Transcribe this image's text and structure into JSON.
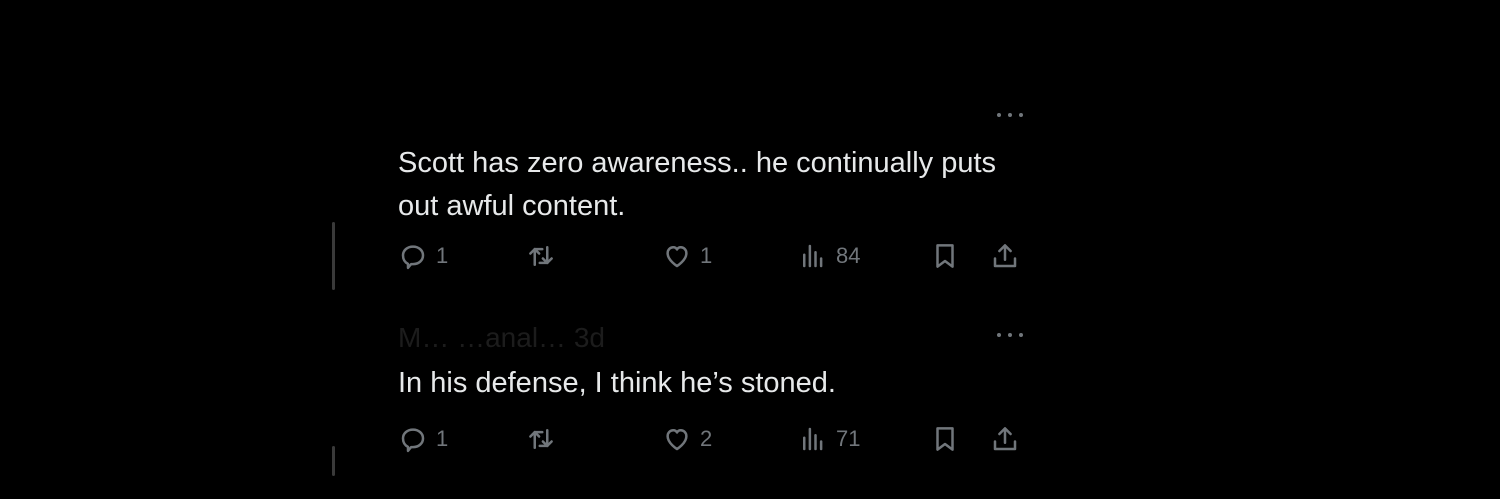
{
  "replies": [
    {
      "meta": "",
      "text": "Scott has zero awareness.. he continually puts out awful content.",
      "replies_count": "1",
      "retweets_count": "",
      "likes_count": "1",
      "views_count": "84"
    },
    {
      "meta": "M… …anal… 3d",
      "text": "In his defense, I think he’s stoned.",
      "replies_count": "1",
      "retweets_count": "",
      "likes_count": "2",
      "views_count": "71"
    }
  ],
  "theme": {
    "background": "#000000",
    "text": "#e7e9ea",
    "muted": "#71767b"
  },
  "icons": [
    "more-icon",
    "reply-icon",
    "retweet-icon",
    "like-icon",
    "views-icon",
    "bookmark-icon",
    "share-icon"
  ]
}
